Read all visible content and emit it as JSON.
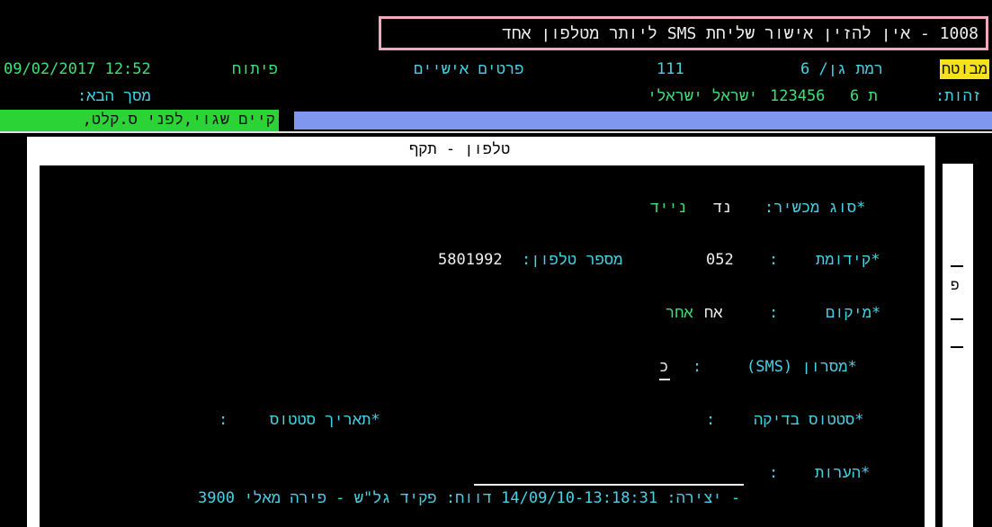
{
  "message_bar": {
    "text": "1008 - אין להזין אישור שליחת SMS ליותר מטלפון אחד"
  },
  "header": {
    "datetime_text": "09/02/2017 12:52",
    "opened_label": "פיתוח",
    "section_title": "פרטים אישיים",
    "code": "111",
    "insured_badge": "מבוטח",
    "rank_text": "רמת גן/ 6",
    "next_screen_label": "מסך הבא:",
    "id_label": "זהות:",
    "id_type": "ת 6",
    "id_number": "123456",
    "citizenship": "ישראל ישראלי"
  },
  "status_strip": {
    "green_text": "קיים שגוי,לפני ס.קלט,"
  },
  "panel": {
    "title": "טלפון - תקף",
    "fields": {
      "device_type_label": "*סוג מכשיר:",
      "device_type_code": "נד",
      "device_type_value": "נייד",
      "prefix_label": "*קידומת",
      "prefix_colon": ":",
      "prefix_value": "052",
      "phone_label": "מספר טלפון:",
      "phone_value": "5801992",
      "location_label": "*מיקום",
      "location_colon": ":",
      "location_code": "אח",
      "location_value": "אחר",
      "sms_label": "*מסרון (SMS)",
      "sms_colon": ":",
      "sms_value": "כ",
      "check_status_label": "*סטטוס בדיקה",
      "check_status_colon": ":",
      "status_date_label": "*תאריך סטטוס",
      "status_date_colon": ":",
      "notes_label": "*הערות",
      "notes_colon": ":",
      "notes_value": ""
    },
    "footer_text": "- יצירה: 14/09/10-13:18:31 דווח: פקיד גל\"ש - פירה מאלי 3900"
  },
  "side": {
    "label": "פ"
  },
  "colors": {
    "background": "#000000",
    "cyan_text": "#46d3e6",
    "green_text": "#3fe07a",
    "insured_badge_bg": "#f5e21b",
    "status_green_bg": "#2bd336",
    "status_blue_bg": "#7f97ee",
    "message_border": "#f3a9bd"
  }
}
